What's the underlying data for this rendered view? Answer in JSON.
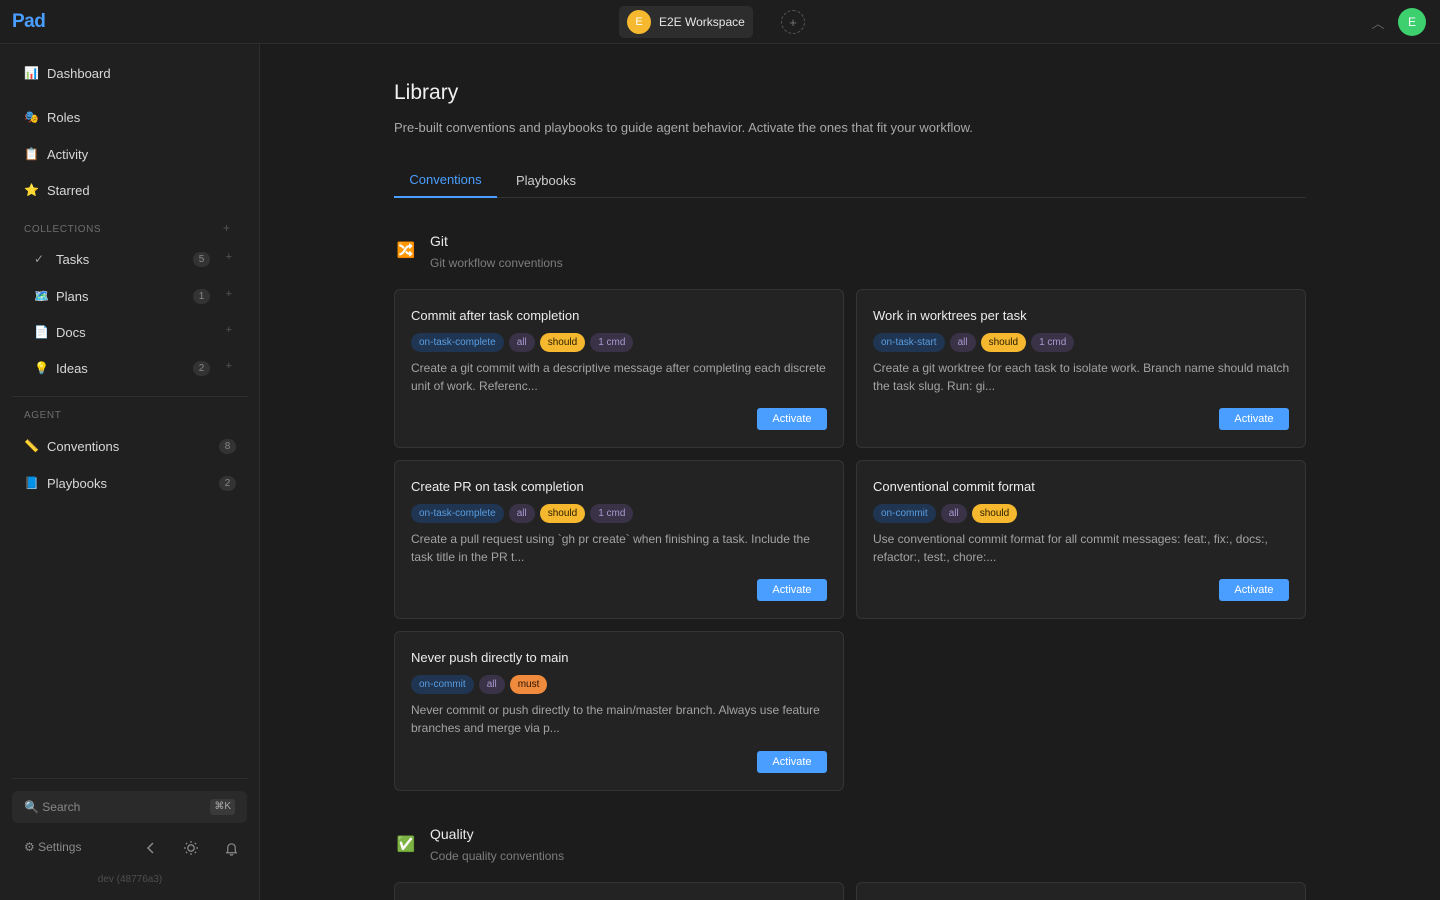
{
  "topbar": {
    "logo": "Pad",
    "workspace_initial": "E",
    "workspace_name": "E2E Workspace",
    "add_workspace": "+",
    "user_initial": "E"
  },
  "sidebar": {
    "nav_top": [
      {
        "label": "Dashboard",
        "icon": "📊"
      },
      {
        "label": "Roles",
        "icon": "🎭"
      },
      {
        "label": "Activity",
        "icon": "📋"
      },
      {
        "label": "Starred",
        "icon": "⭐"
      }
    ],
    "collections_label": "COLLECTIONS",
    "collections": [
      {
        "label": "Tasks",
        "icon": "✓",
        "count": "5"
      },
      {
        "label": "Plans",
        "icon": "🗺️",
        "count": "1"
      },
      {
        "label": "Docs",
        "icon": "📄",
        "count": ""
      },
      {
        "label": "Ideas",
        "icon": "💡",
        "count": "2"
      }
    ],
    "agent_label": "AGENT",
    "agent": [
      {
        "label": "Conventions",
        "icon": "📏",
        "count": "8"
      },
      {
        "label": "Playbooks",
        "icon": "📘",
        "count": "2"
      }
    ],
    "search_placeholder": "🔍 Search",
    "search_shortcut": "⌘K",
    "settings_label": "⚙ Settings",
    "version": "dev (48776a3)"
  },
  "main": {
    "title": "Library",
    "description": "Pre-built conventions and playbooks to guide agent behavior. Activate the ones that fit your workflow.",
    "tabs": [
      {
        "label": "Conventions",
        "active": true
      },
      {
        "label": "Playbooks",
        "active": false
      }
    ],
    "sections": [
      {
        "icon": "🔀",
        "title": "Git",
        "subtitle": "Git workflow conventions",
        "cards": [
          {
            "title": "Commit after task completion",
            "tags": [
              "on-task-complete",
              "all",
              "should",
              "1 cmd"
            ],
            "desc": "Create a git commit with a descriptive message after completing each discrete unit of work. Referenc...",
            "button": "Activate"
          },
          {
            "title": "Work in worktrees per task",
            "tags": [
              "on-task-start",
              "all",
              "should",
              "1 cmd"
            ],
            "desc": "Create a git worktree for each task to isolate work. Branch name should match the task slug. Run: gi...",
            "button": "Activate"
          },
          {
            "title": "Create PR on task completion",
            "tags": [
              "on-task-complete",
              "all",
              "should",
              "1 cmd"
            ],
            "desc": "Create a pull request using `gh pr create` when finishing a task. Include the task title in the PR t...",
            "button": "Activate"
          },
          {
            "title": "Conventional commit format",
            "tags": [
              "on-commit",
              "all",
              "should"
            ],
            "desc": "Use conventional commit format for all commit messages: feat:, fix:, docs:, refactor:, test:, chore:...",
            "button": "Activate"
          },
          {
            "title": "Never push directly to main",
            "tags": [
              "on-commit",
              "all",
              "must"
            ],
            "desc": "Never commit or push directly to the main/master branch. Always use feature branches and merge via p...",
            "button": "Activate"
          }
        ]
      },
      {
        "icon": "✅",
        "title": "Quality",
        "subtitle": "Code quality conventions"
      }
    ]
  },
  "colors": {
    "accent": "#4a9eff",
    "should": "#f5b82e",
    "must": "#f08a3c",
    "user_avatar": "#3ecf6e",
    "workspace_avatar": "#f5b82e"
  }
}
